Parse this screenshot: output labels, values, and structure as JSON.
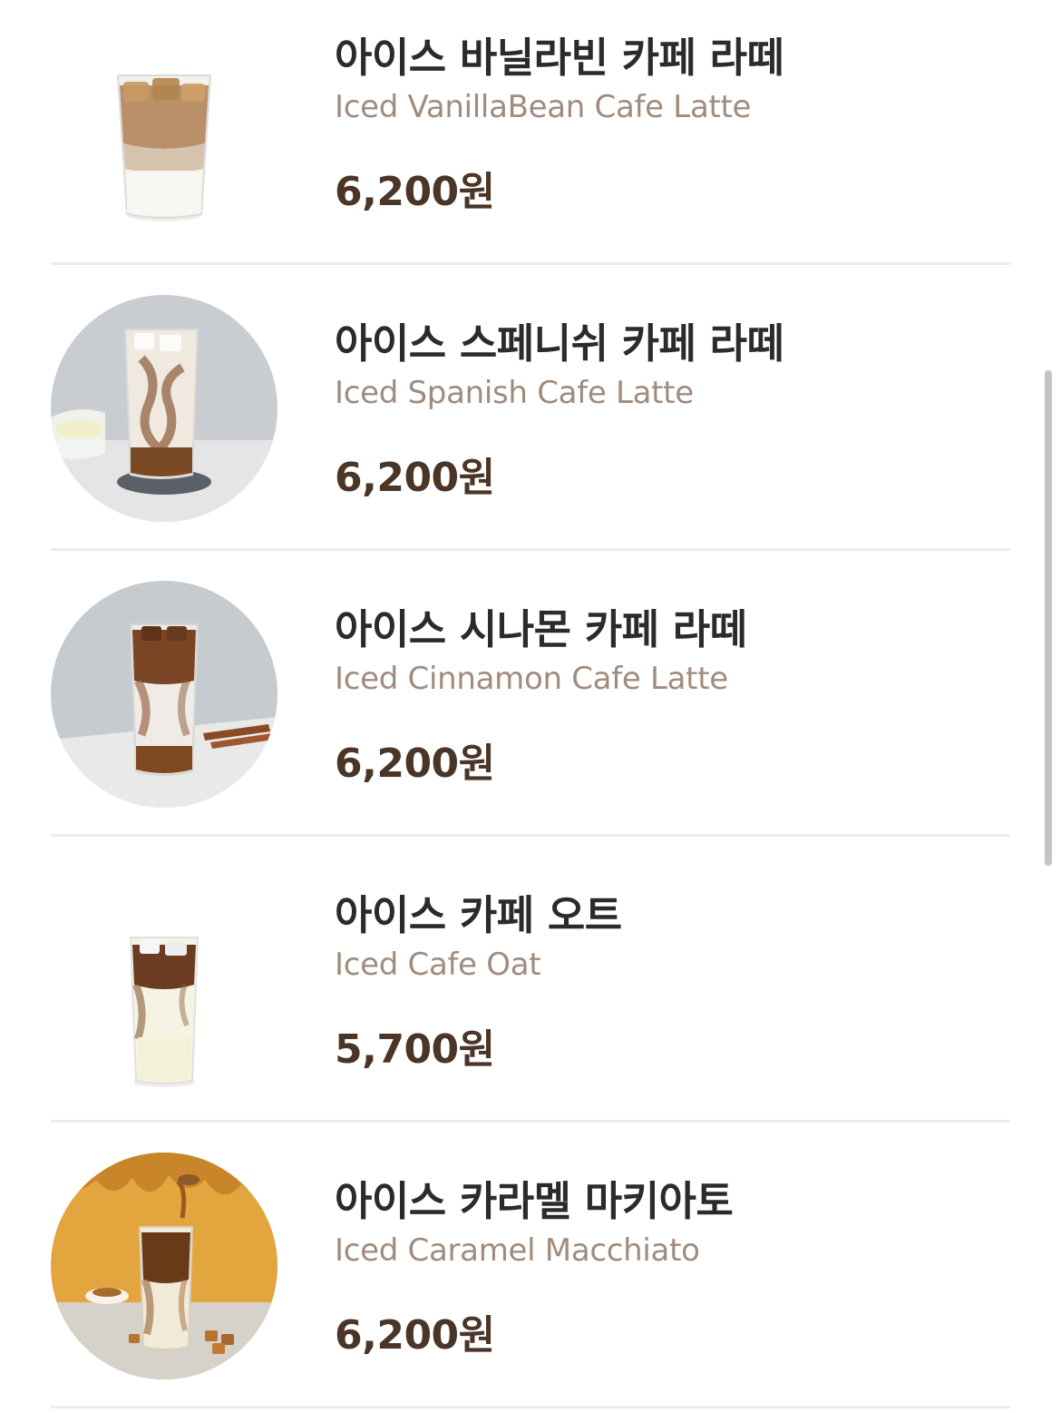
{
  "menu": {
    "items": [
      {
        "name_ko": "아이스 바닐라빈 카페 라떼",
        "name_en": "Iced VanillaBean Cafe Latte",
        "price": "6,200원",
        "image": "iced-vanillabean-latte-image"
      },
      {
        "name_ko": "아이스 스페니쉬 카페 라떼",
        "name_en": "Iced Spanish Cafe Latte",
        "price": "6,200원",
        "image": "iced-spanish-latte-image"
      },
      {
        "name_ko": "아이스 시나몬 카페 라떼",
        "name_en": "Iced Cinnamon Cafe Latte",
        "price": "6,200원",
        "image": "iced-cinnamon-latte-image"
      },
      {
        "name_ko": "아이스 카페 오트",
        "name_en": "Iced Cafe Oat",
        "price": "5,700원",
        "image": "iced-cafe-oat-image"
      },
      {
        "name_ko": "아이스 카라멜 마키아토",
        "name_en": "Iced Caramel Macchiato",
        "price": "6,200원",
        "image": "iced-caramel-macchiato-image"
      }
    ]
  },
  "colors": {
    "name_ko": "#2b2b2b",
    "name_en": "#a08c7e",
    "price": "#4a3526",
    "divider": "#ececec"
  }
}
